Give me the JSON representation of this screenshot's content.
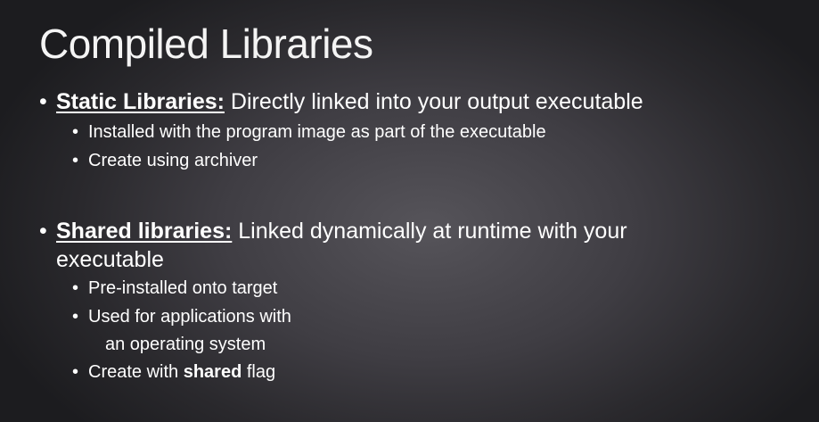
{
  "slide": {
    "title": "Compiled Libraries",
    "bullets": [
      {
        "key": "Static Libraries:",
        "text": "Directly linked into your output executable",
        "sub": [
          "Installed with the program image as part of the executable",
          "Create using archiver"
        ]
      },
      {
        "key": "Shared libraries:",
        "text": "Linked dynamically at runtime with your",
        "text_cont": "executable",
        "sub": [
          "Pre-installed onto target",
          "Used for applications with",
          "an operating system"
        ],
        "last_sub": {
          "pre": "Create with",
          "bold": "shared",
          "post": "flag"
        }
      }
    ],
    "bullet_glyph": "•"
  }
}
